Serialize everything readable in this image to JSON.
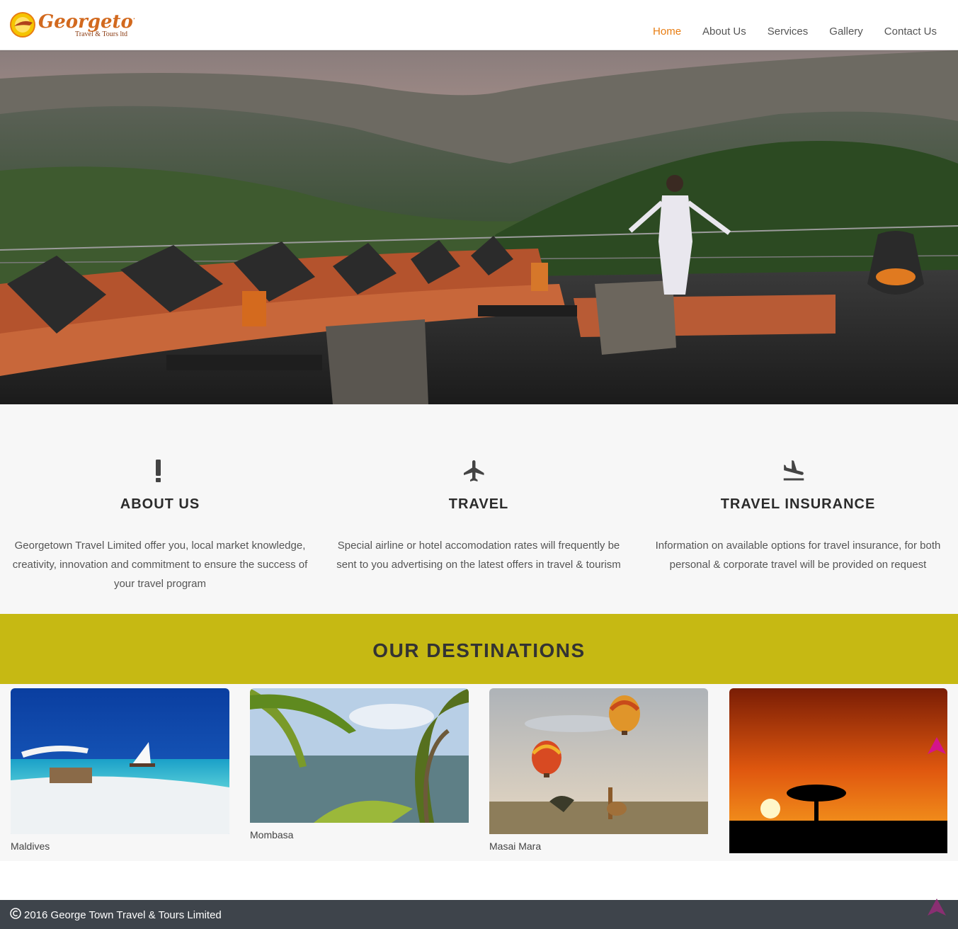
{
  "brand": {
    "name": "Georgetown",
    "tagline": "Travel & Tours ltd"
  },
  "nav": {
    "items": [
      {
        "label": "Home",
        "active": true
      },
      {
        "label": "About Us",
        "active": false
      },
      {
        "label": "Services",
        "active": false
      },
      {
        "label": "Gallery",
        "active": false
      },
      {
        "label": "Contact Us",
        "active": false
      }
    ],
    "active_color": "#e87d12"
  },
  "features": [
    {
      "icon": "exclamation-icon",
      "title": "ABOUT US",
      "text": "Georgetown Travel Limited offer you, local market knowledge, creativity, innovation and commitment to ensure the success of your travel program"
    },
    {
      "icon": "airplane-icon",
      "title": "TRAVEL",
      "text": "Special airline or hotel accomodation rates will frequently be sent to you advertising on the latest offers in travel & tourism"
    },
    {
      "icon": "flight-land-icon",
      "title": "TRAVEL INSURANCE",
      "text": "Information on available options for travel insurance, for both personal & corporate travel will be provided on request"
    }
  ],
  "destinations": {
    "heading": "OUR DESTINATIONS",
    "band_color": "#c6b913",
    "items": [
      {
        "name": "Maldives"
      },
      {
        "name": "Mombasa"
      },
      {
        "name": "Masai Mara"
      },
      {
        "name": ""
      }
    ]
  },
  "footer": {
    "copyright": "2016 George Town Travel & Tours Limited",
    "background": "#3e444b"
  },
  "scroll_top_color": "#d4148c"
}
